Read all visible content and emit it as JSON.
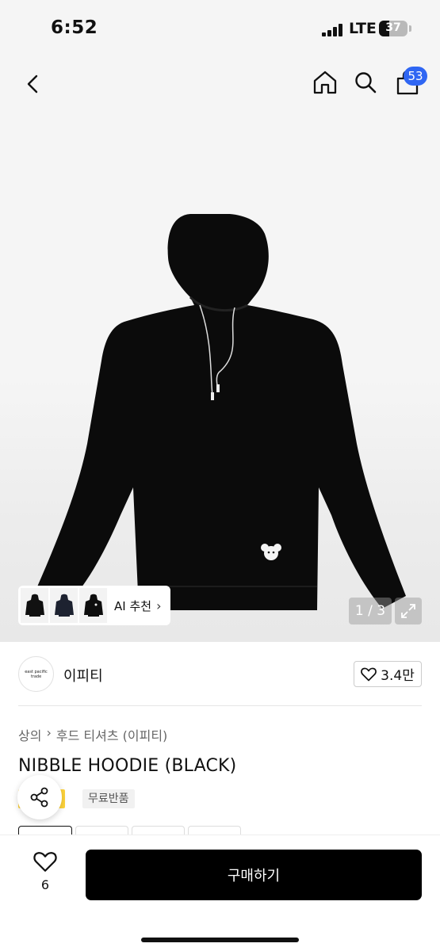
{
  "status_bar": {
    "time": "6:52",
    "network": "LTE",
    "battery": "37",
    "battery_level_percent": 37
  },
  "header": {
    "icons": [
      "back-chevron-icon",
      "home-icon",
      "search-icon",
      "shopping-bag-icon"
    ],
    "cart_count": "53",
    "accent_color": "#2f66f3"
  },
  "gallery": {
    "ai_recommend_label": "AI 추천",
    "page_counter": "1 / 3",
    "thumbnail_count": 3
  },
  "seller": {
    "logo_text": "east pacific trade",
    "name": "이피티",
    "likes": "3.4만"
  },
  "product": {
    "breadcrumb": [
      "상의",
      "후드 티셔츠 (이피티)"
    ],
    "title": "NIBBLE HOODIE (BLACK)",
    "badge_partial": "일",
    "badge_free_return": "무료반품"
  },
  "bottom_bar": {
    "wishlist_count": "6",
    "buy_label": "구매하기"
  }
}
